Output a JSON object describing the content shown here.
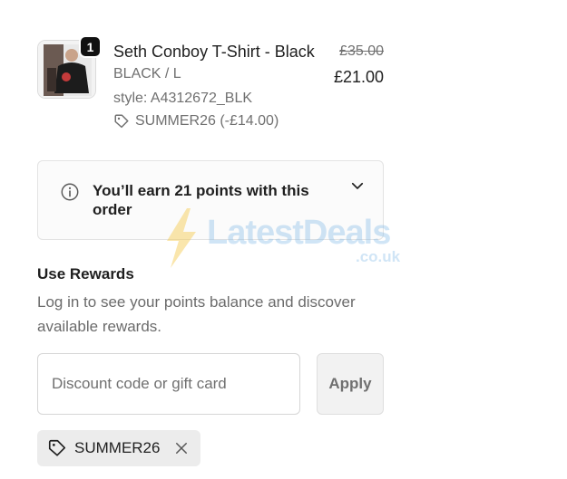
{
  "product": {
    "quantity": "1",
    "title": "Seth Conboy T-Shirt - Black",
    "variant": "BLACK / L",
    "style": "style: A4312672_BLK",
    "discount": "SUMMER26 (-£14.00)",
    "original_price": "£35.00",
    "price": "£21.00",
    "image_icon": "product-photo"
  },
  "points": {
    "message": "You’ll earn 21 points with this order",
    "icon": "info-icon",
    "toggle_icon": "chevron-down-icon"
  },
  "watermark": {
    "brand": "LatestDeals",
    "domain": ".co.uk"
  },
  "rewards": {
    "title": "Use Rewards",
    "description": "Log in to see your points balance and discover available rewards."
  },
  "discount_form": {
    "placeholder": "Discount code or gift card",
    "value": "",
    "apply_label": "Apply"
  },
  "applied_code": {
    "code": "SUMMER26",
    "icon": "tag-icon",
    "remove_icon": "close-icon"
  },
  "colors": {
    "text": "#1f1f1f",
    "muted": "#707070",
    "badge": "#111111",
    "chip_bg": "#ececec"
  }
}
